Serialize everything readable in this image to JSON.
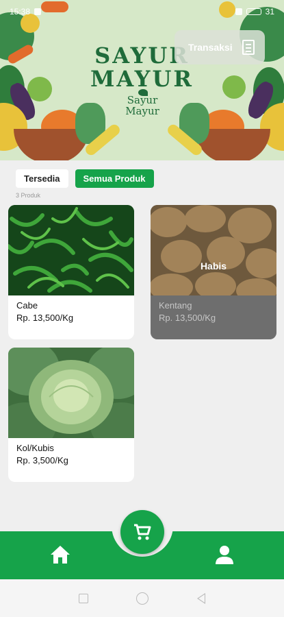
{
  "status_bar": {
    "time": "15:38",
    "battery": "31"
  },
  "header": {
    "brand_line1": "SAYUR",
    "brand_line2": "MAYUR",
    "logo_line1": "Sayur",
    "logo_line2": "Mayur",
    "transaksi_label": "Transaksi",
    "transaksi_icon": "receipt-icon"
  },
  "filters": {
    "available_label": "Tersedia",
    "all_label": "Semua Produk",
    "product_count": "3 Produk"
  },
  "products": [
    {
      "name": "Cabe",
      "price": "Rp. 13,500/Kg",
      "status": ""
    },
    {
      "name": "Kentang",
      "price": "Rp. 13,500/Kg",
      "status": "Habis"
    },
    {
      "name": "Kol/Kubis",
      "price": "Rp. 3,500/Kg",
      "status": ""
    }
  ],
  "nav": {
    "home_icon": "home-icon",
    "cart_icon": "cart-icon",
    "profile_icon": "person-icon"
  },
  "colors": {
    "accent": "#16a34a",
    "brand": "#1f6b3a",
    "background": "#efefef"
  }
}
